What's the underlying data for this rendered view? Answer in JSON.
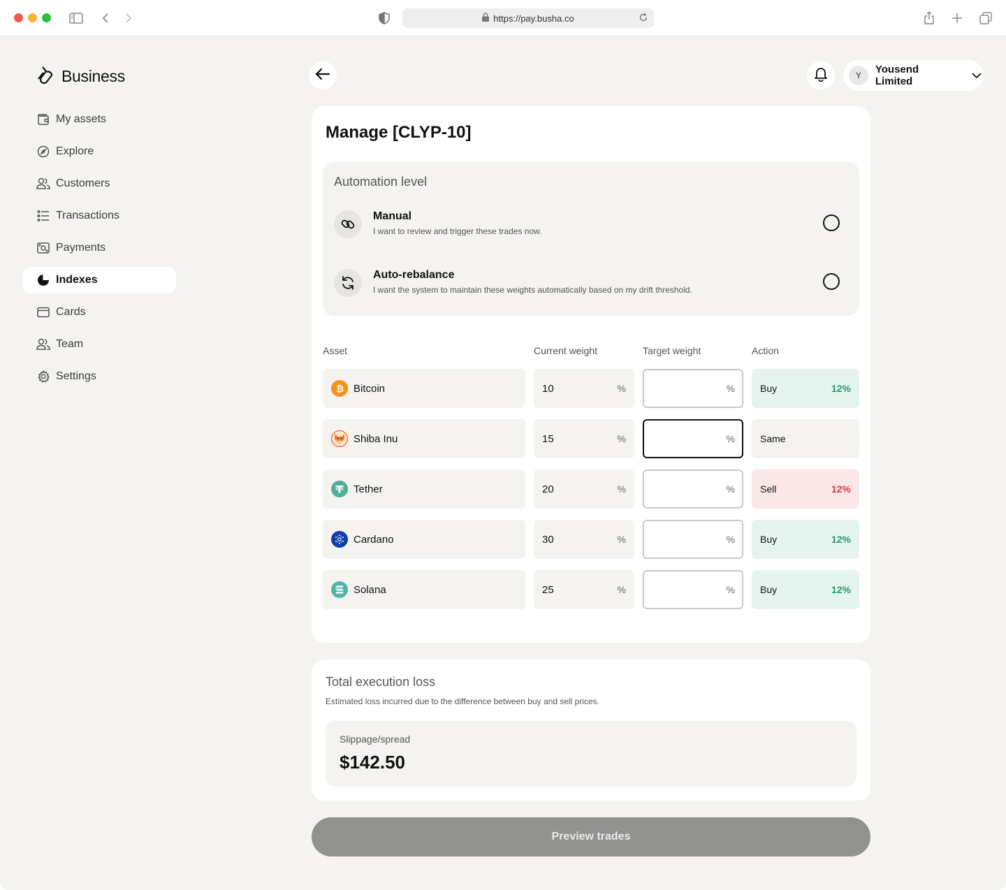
{
  "browser": {
    "url": "https://pay.busha.co"
  },
  "sidebar": {
    "logo_text": "Business",
    "items": [
      {
        "label": "My assets",
        "icon": "wallet-icon",
        "active": false
      },
      {
        "label": "Explore",
        "icon": "compass-icon",
        "active": false
      },
      {
        "label": "Customers",
        "icon": "users-icon",
        "active": false
      },
      {
        "label": "Transactions",
        "icon": "list-icon",
        "active": false
      },
      {
        "label": "Payments",
        "icon": "cash-icon",
        "active": false
      },
      {
        "label": "Indexes",
        "icon": "pie-chart-icon",
        "active": true
      },
      {
        "label": "Cards",
        "icon": "card-icon",
        "active": false
      },
      {
        "label": "Team",
        "icon": "team-icon",
        "active": false
      },
      {
        "label": "Settings",
        "icon": "gear-icon",
        "active": false
      }
    ]
  },
  "header": {
    "account_initial": "Y",
    "account_name": "Yousend Limited"
  },
  "manage": {
    "title": "Manage [CLYP-10]",
    "automation": {
      "title": "Automation level",
      "options": [
        {
          "title": "Manual",
          "description": "I want to review and trigger these trades now.",
          "icon": "link-icon",
          "selected": false
        },
        {
          "title": "Auto-rebalance",
          "description": "I want the system to maintain these weights automatically based on my drift threshold.",
          "icon": "refresh-icon",
          "selected": false
        }
      ]
    },
    "table": {
      "headers": [
        "Asset",
        "Current weight",
        "Target weight",
        "Action"
      ],
      "percent_symbol": "%",
      "rows": [
        {
          "asset": "Bitcoin",
          "coin_color": "#f7931a",
          "current": "10",
          "target": "",
          "action": "Buy",
          "action_value": "12%",
          "kind": "buy"
        },
        {
          "asset": "Shiba Inu",
          "coin_color": "#e0482a",
          "current": "15",
          "target": "",
          "action": "Same",
          "action_value": "",
          "kind": "same"
        },
        {
          "asset": "Tether",
          "coin_color": "#50af95",
          "current": "20",
          "target": "",
          "action": "Sell",
          "action_value": "12%",
          "kind": "sell"
        },
        {
          "asset": "Cardano",
          "coin_color": "#0d3fa8",
          "current": "30",
          "target": "",
          "action": "Buy",
          "action_value": "12%",
          "kind": "buy"
        },
        {
          "asset": "Solana",
          "coin_color": "#4fb7a3",
          "current": "25",
          "target": "",
          "action": "Buy",
          "action_value": "12%",
          "kind": "buy"
        }
      ]
    }
  },
  "execution_loss": {
    "title": "Total execution loss",
    "description": "Estimated loss incurred due to the difference between buy and sell prices.",
    "label": "Slippage/spread",
    "value": "$142.50"
  },
  "preview_button": "Preview trades",
  "colors": {
    "page_bg": "#f4f3f0",
    "buy_bg": "#e6f4ef",
    "buy_text": "#1f9d63",
    "sell_bg": "#fbe7e7",
    "sell_text": "#d93a3a",
    "button_disabled": "#919190"
  }
}
